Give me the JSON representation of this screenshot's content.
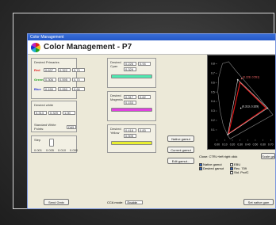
{
  "window": {
    "title": "Color Management"
  },
  "app": {
    "title": "Color Management - P7"
  },
  "primaries": {
    "label": "Desired Primaries",
    "rows": [
      {
        "name": "Red",
        "x": "0.637",
        "y": "0.322",
        "gain": "0.70",
        "color": "#e02020"
      },
      {
        "name": "Green",
        "x": "0.306",
        "y": "0.595",
        "gain": "0.70",
        "color": "#20a020"
      },
      {
        "name": "Blue",
        "x": "0.150",
        "y": "0.060",
        "gain": "0.66",
        "color": "#2030d0"
      }
    ]
  },
  "white": {
    "label": "Desired white",
    "x": "0.313",
    "y": "0.329",
    "gain": "1.00",
    "point_label": "Standard White Points:",
    "point_value": "D65"
  },
  "step": {
    "label": "Step",
    "min": "0.001",
    "v1": "0.005",
    "v2": "0.010",
    "max": "0.050"
  },
  "cyan": {
    "label": "Desired Cyan",
    "x": "0.226",
    "y": "0.329",
    "gain": "0.94",
    "color": "#4ee9b0"
  },
  "magenta": {
    "label": "Desired Magenta",
    "x": "0.317",
    "y": "0.153",
    "gain": "0.62",
    "color": "#e040e0"
  },
  "yellow": {
    "label": "Desired Yellow",
    "x": "0.418",
    "y": "0.505",
    "gain": "0.83",
    "color": "#e8ee30"
  },
  "buttons": {
    "native": "Native gamut",
    "current": "Current gamut",
    "edit": "Edit gamut...",
    "send": "Send Gmtx",
    "set_native": "Set native gam"
  },
  "options": {
    "native_gamut": "Native gamut",
    "desired_gamut": "Desired gamut",
    "hint": "Close: CTRL+left right click",
    "tab": "Scale ga",
    "ebu": "EBU",
    "rec709": "Rec. 709",
    "smpte": "Std. ProfC"
  },
  "cca": {
    "label": "CCA mode:",
    "value": "Enable"
  },
  "chart_data": {
    "type": "scatter",
    "xlabel": "",
    "ylabel": "",
    "x_ticks": [
      "0.00",
      "0.10",
      "0.20",
      "0.30",
      "0.40",
      "0.50",
      "0.60",
      "0.70"
    ],
    "y_ticks": [
      "0.1",
      "0.2",
      "0.3",
      "0.4",
      "0.5",
      "0.6",
      "0.7",
      "0.8"
    ],
    "triangles": [
      {
        "name": "desired",
        "color": "#e01818",
        "points": [
          [
            0.64,
            0.33
          ],
          [
            0.3,
            0.6
          ],
          [
            0.15,
            0.06
          ]
        ]
      },
      {
        "name": "native",
        "color": "#e0e0e0",
        "points": [
          [
            0.66,
            0.33
          ],
          [
            0.27,
            0.63
          ],
          [
            0.14,
            0.05
          ]
        ]
      }
    ],
    "labels": [
      {
        "text": "(0.228, 0.591)",
        "x": 0.32,
        "y": 0.64,
        "color": "#ff6b6b"
      },
      {
        "text": "(0.313, 0.329)",
        "x": 0.31,
        "y": 0.33,
        "color": "#ffffff"
      }
    ]
  }
}
